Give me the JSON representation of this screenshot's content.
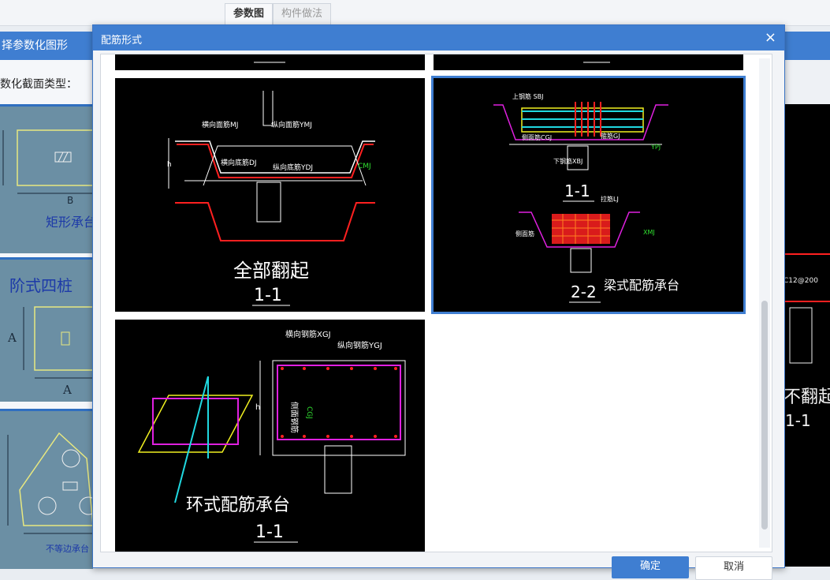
{
  "top_tabs": {
    "params_tab": "参数图",
    "method_tab": "构件做法"
  },
  "bg_left": {
    "header": "择参数化图形",
    "label": "数化截面类型：",
    "thumb1": {
      "dim_b": "B",
      "name": "矩形承台"
    },
    "thumb2": {
      "name": "阶式四桩",
      "dim_a1": "A",
      "dim_a2": "A"
    },
    "thumb3": {
      "name": "不等边承台"
    }
  },
  "bg_right": {
    "text_title": "不翻起",
    "text_section": "1-1",
    "text_small": "C12@200"
  },
  "dialog": {
    "title": "配筋形式",
    "close_icon": "×",
    "ok_label": "确定",
    "cancel_label": "取消"
  },
  "cards": {
    "full_fold": {
      "caption": "全部翻起",
      "section": "1-1",
      "labels": {
        "hmj": "横向面筋MJ",
        "ymj": "纵向面筋YMJ",
        "hdj": "横向底筋DJ",
        "ydj": "纵向底筋YDJ",
        "cmj": "CMJ",
        "h": "h"
      }
    },
    "beam": {
      "caption": "梁式配筋承台",
      "section1": "1-1",
      "section2": "2-2",
      "labels": {
        "top": "上钢筋 SBJ",
        "bottom": "下钢筋XBJ",
        "side": "侧面筋CGJ",
        "stirrup": "箍筋GJ",
        "lj": "拉筋LJ",
        "side2": "侧面筋",
        "xmj": "XMJ",
        "ypj": "YPJ"
      }
    },
    "ring": {
      "caption": "环式配筋承台",
      "section": "1-1",
      "labels": {
        "h": "横向钢筋XGJ",
        "v": "纵向钢筋YGJ",
        "side": "侧面钢筋",
        "cgj": "CGJ",
        "h_dim": "h"
      }
    }
  },
  "colors": {
    "accent": "#3f7ed1",
    "rebar_red": "#ff2020",
    "line_white": "#ffffff",
    "label_green": "#30e030",
    "magenta": "#e020e0",
    "yellow": "#f0f020",
    "cyan": "#20d8e0"
  }
}
